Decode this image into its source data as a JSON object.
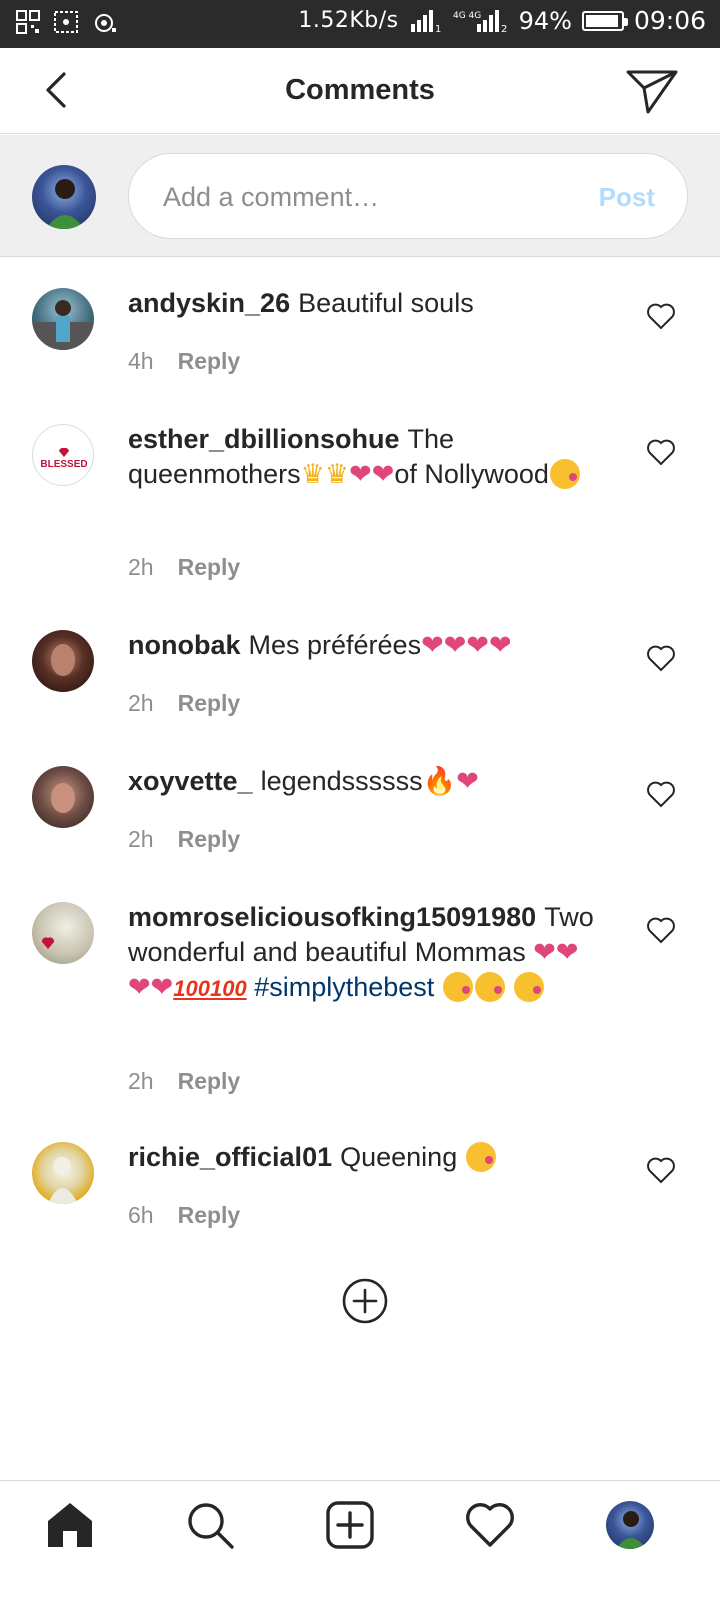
{
  "status_bar": {
    "net_speed": "1.52Kb/s",
    "sim1": "1",
    "sim2_label": "4G 4G",
    "sim2": "2",
    "battery": "94%",
    "battery_level": 0.94,
    "time": "09:06"
  },
  "header": {
    "title": "Comments"
  },
  "composer": {
    "placeholder": "Add a comment…",
    "post_label": "Post"
  },
  "comments": [
    {
      "username": "andyskin_26",
      "text": "Beautiful souls",
      "time": "4h",
      "reply": "Reply"
    },
    {
      "username": "esther_dbillionsohue",
      "text": "The queenmothers",
      "text_end": "of Nollywood",
      "time": "2h",
      "reply": "Reply",
      "avatar_text": "BLESSED"
    },
    {
      "username": "nonobak",
      "text": "Mes préférées",
      "time": "2h",
      "reply": "Reply"
    },
    {
      "username": "xoyvette_",
      "text": "legendssssss",
      "time": "2h",
      "reply": "Reply"
    },
    {
      "username": "momroseliciousofking15091980",
      "text": "Two wonderful and beautiful Mommas",
      "hashtag": "#simplythebest",
      "time": "2h",
      "reply": "Reply"
    },
    {
      "username": "richie_official01",
      "text": "Queening",
      "time": "6h",
      "reply": "Reply"
    }
  ],
  "emoji": {
    "heart": "❤",
    "fire": "🔥",
    "crown": "♛",
    "hundred": "100"
  },
  "bottom_nav": {
    "items": [
      "home-icon",
      "search-icon",
      "new-post-icon",
      "activity-icon",
      "profile-avatar"
    ]
  },
  "colors": {
    "status_bar": "#2b2b2b",
    "composer_bg": "#efefef",
    "post_disabled": "#b3dbff",
    "hashtag": "#00376b",
    "secondary_text": "#8e8e8e"
  }
}
